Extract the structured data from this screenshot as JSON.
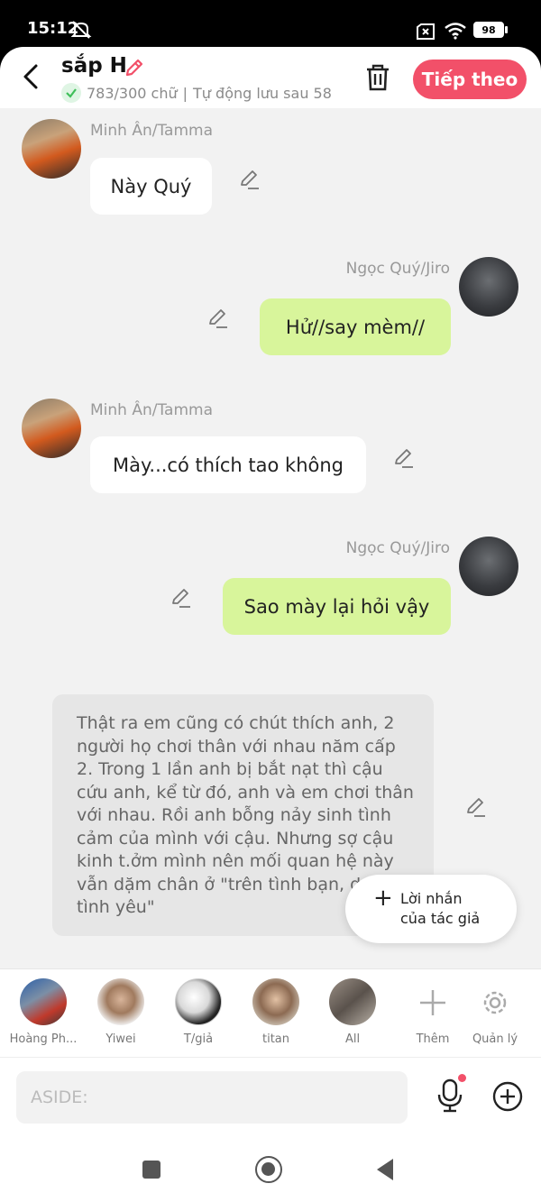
{
  "status_bar": {
    "time": "15:12",
    "battery": "98"
  },
  "header": {
    "title": "sắp H",
    "word_count": "783/300 chữ",
    "autosave": "Tự động lưu sau 58",
    "next_label": "Tiếp theo"
  },
  "messages": [
    {
      "sender": "Minh Ân/Tamma",
      "text": "Này Quý"
    },
    {
      "sender": "Ngọc Quý/Jiro",
      "text": "Hử//say mèm//"
    },
    {
      "sender": "Minh Ân/Tamma",
      "text": "Mày...có thích tao không"
    },
    {
      "sender": "Ngọc Quý/Jiro",
      "text": "Sao mày lại hỏi vậy"
    }
  ],
  "narration": {
    "lines": [
      "Thật ra em cũng có chút thích anh, 2",
      "người họ chơi thân với nhau năm cấp",
      "2. Trong 1 lần anh bị bắt nạt thì cậu",
      "cứu anh, kể từ đó, anh và em chơi thân",
      "với nhau. Rồi anh bỗng nảy sinh tình",
      "cảm của mình với cậu. Nhưng sợ cậu",
      "kinh t.ởm mình nên mối quan hệ này",
      "vẫn dặm chân ở \"trên tình bạn, d",
      "tình yêu\""
    ]
  },
  "author_note": {
    "line1": "Lời nhắn",
    "line2": "của tác giả"
  },
  "characters": [
    {
      "label": "Hoàng Ph..."
    },
    {
      "label": "Yiwei"
    },
    {
      "label": "T/giả"
    },
    {
      "label": "titan"
    },
    {
      "label": "All"
    },
    {
      "label": "Thêm"
    },
    {
      "label": "Quản lý"
    }
  ],
  "input": {
    "placeholder": "ASIDE:"
  }
}
